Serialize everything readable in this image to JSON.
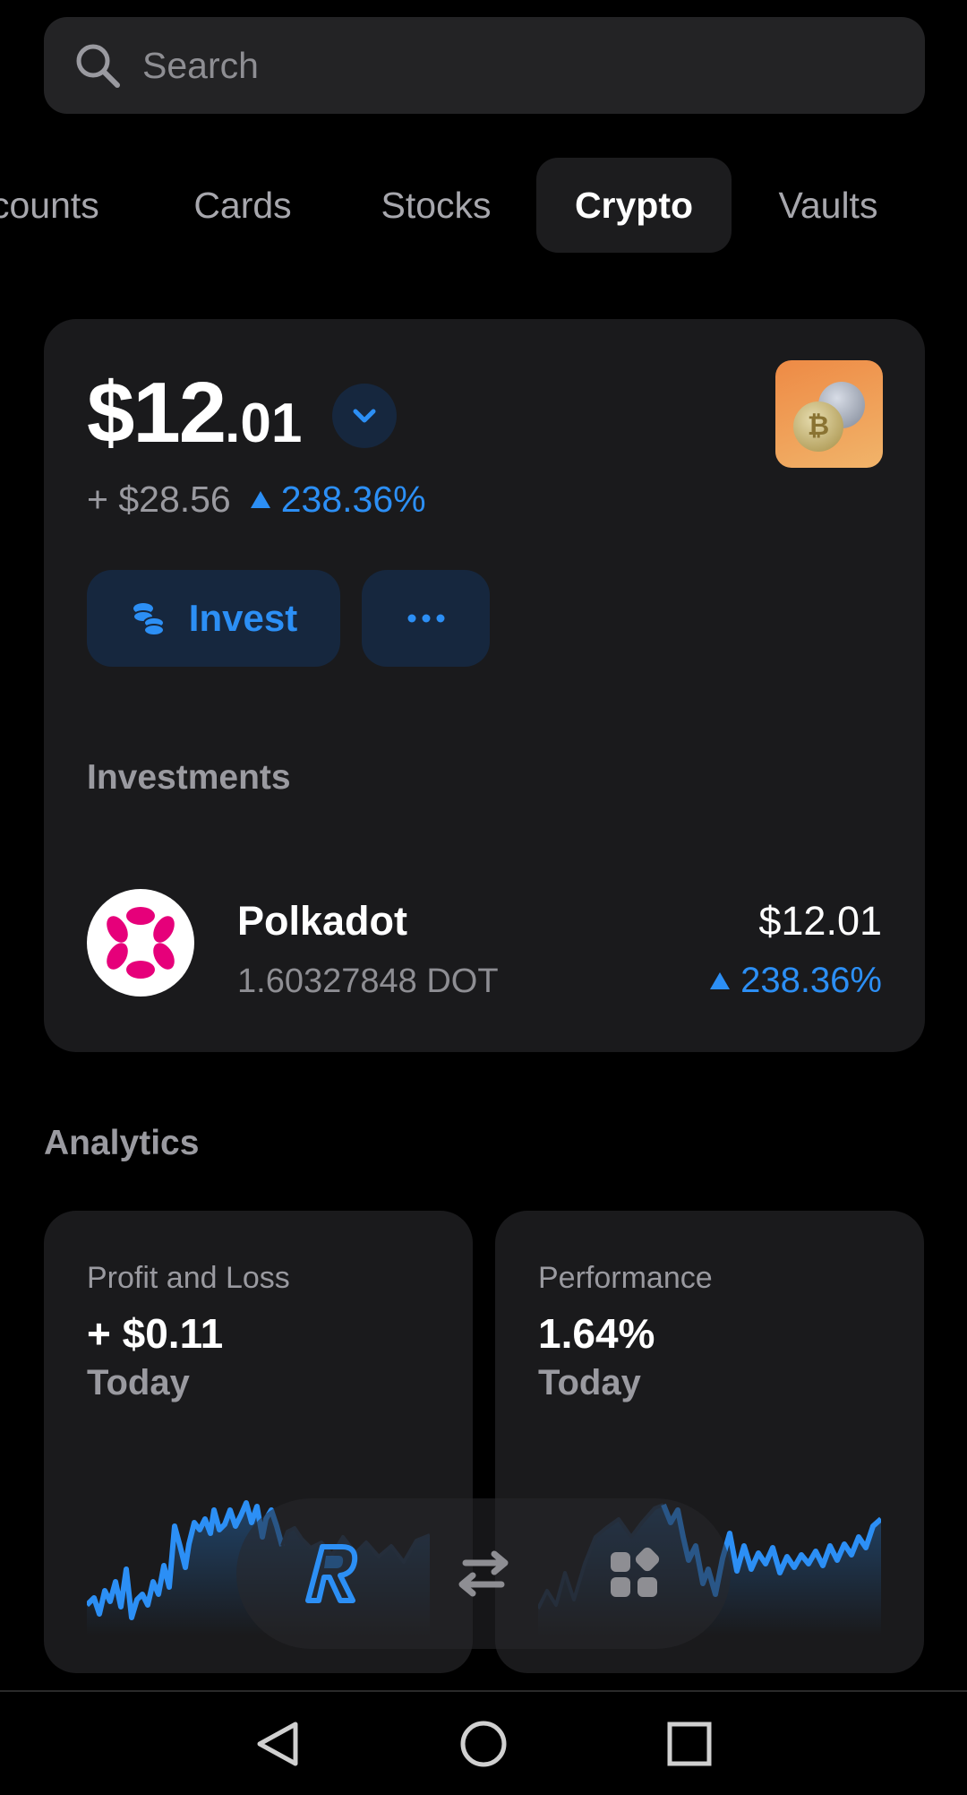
{
  "search": {
    "placeholder": "Search"
  },
  "tabs": [
    {
      "label": "Accounts",
      "visible_text": "counts"
    },
    {
      "label": "Cards"
    },
    {
      "label": "Stocks"
    },
    {
      "label": "Crypto",
      "active": true
    },
    {
      "label": "Vaults"
    }
  ],
  "balance": {
    "main": "$12",
    "decimals": ".01",
    "change_amount": "+ $28.56",
    "change_percent": "238.36%"
  },
  "actions": {
    "invest_label": "Invest",
    "more_label": "···"
  },
  "investments": {
    "title": "Investments",
    "items": [
      {
        "name": "Polkadot",
        "quantity": "1.60327848 DOT",
        "value": "$12.01",
        "change": "238.36%",
        "icon": "polkadot-icon"
      }
    ]
  },
  "analytics": {
    "title": "Analytics",
    "cards": [
      {
        "title": "Profit and Loss",
        "value": "+ $0.11",
        "period": "Today"
      },
      {
        "title": "Performance",
        "value": "1.64%",
        "period": "Today"
      }
    ]
  },
  "bottom_nav": {
    "items": [
      "revolut-home-icon",
      "transfer-icon",
      "apps-grid-icon"
    ]
  },
  "system_nav": {
    "items": [
      "back-icon",
      "home-icon",
      "recents-icon"
    ]
  },
  "colors": {
    "accent": "#2c8ff5",
    "background": "#000000",
    "card": "#1a1a1c",
    "polkadot": "#e6007a"
  }
}
